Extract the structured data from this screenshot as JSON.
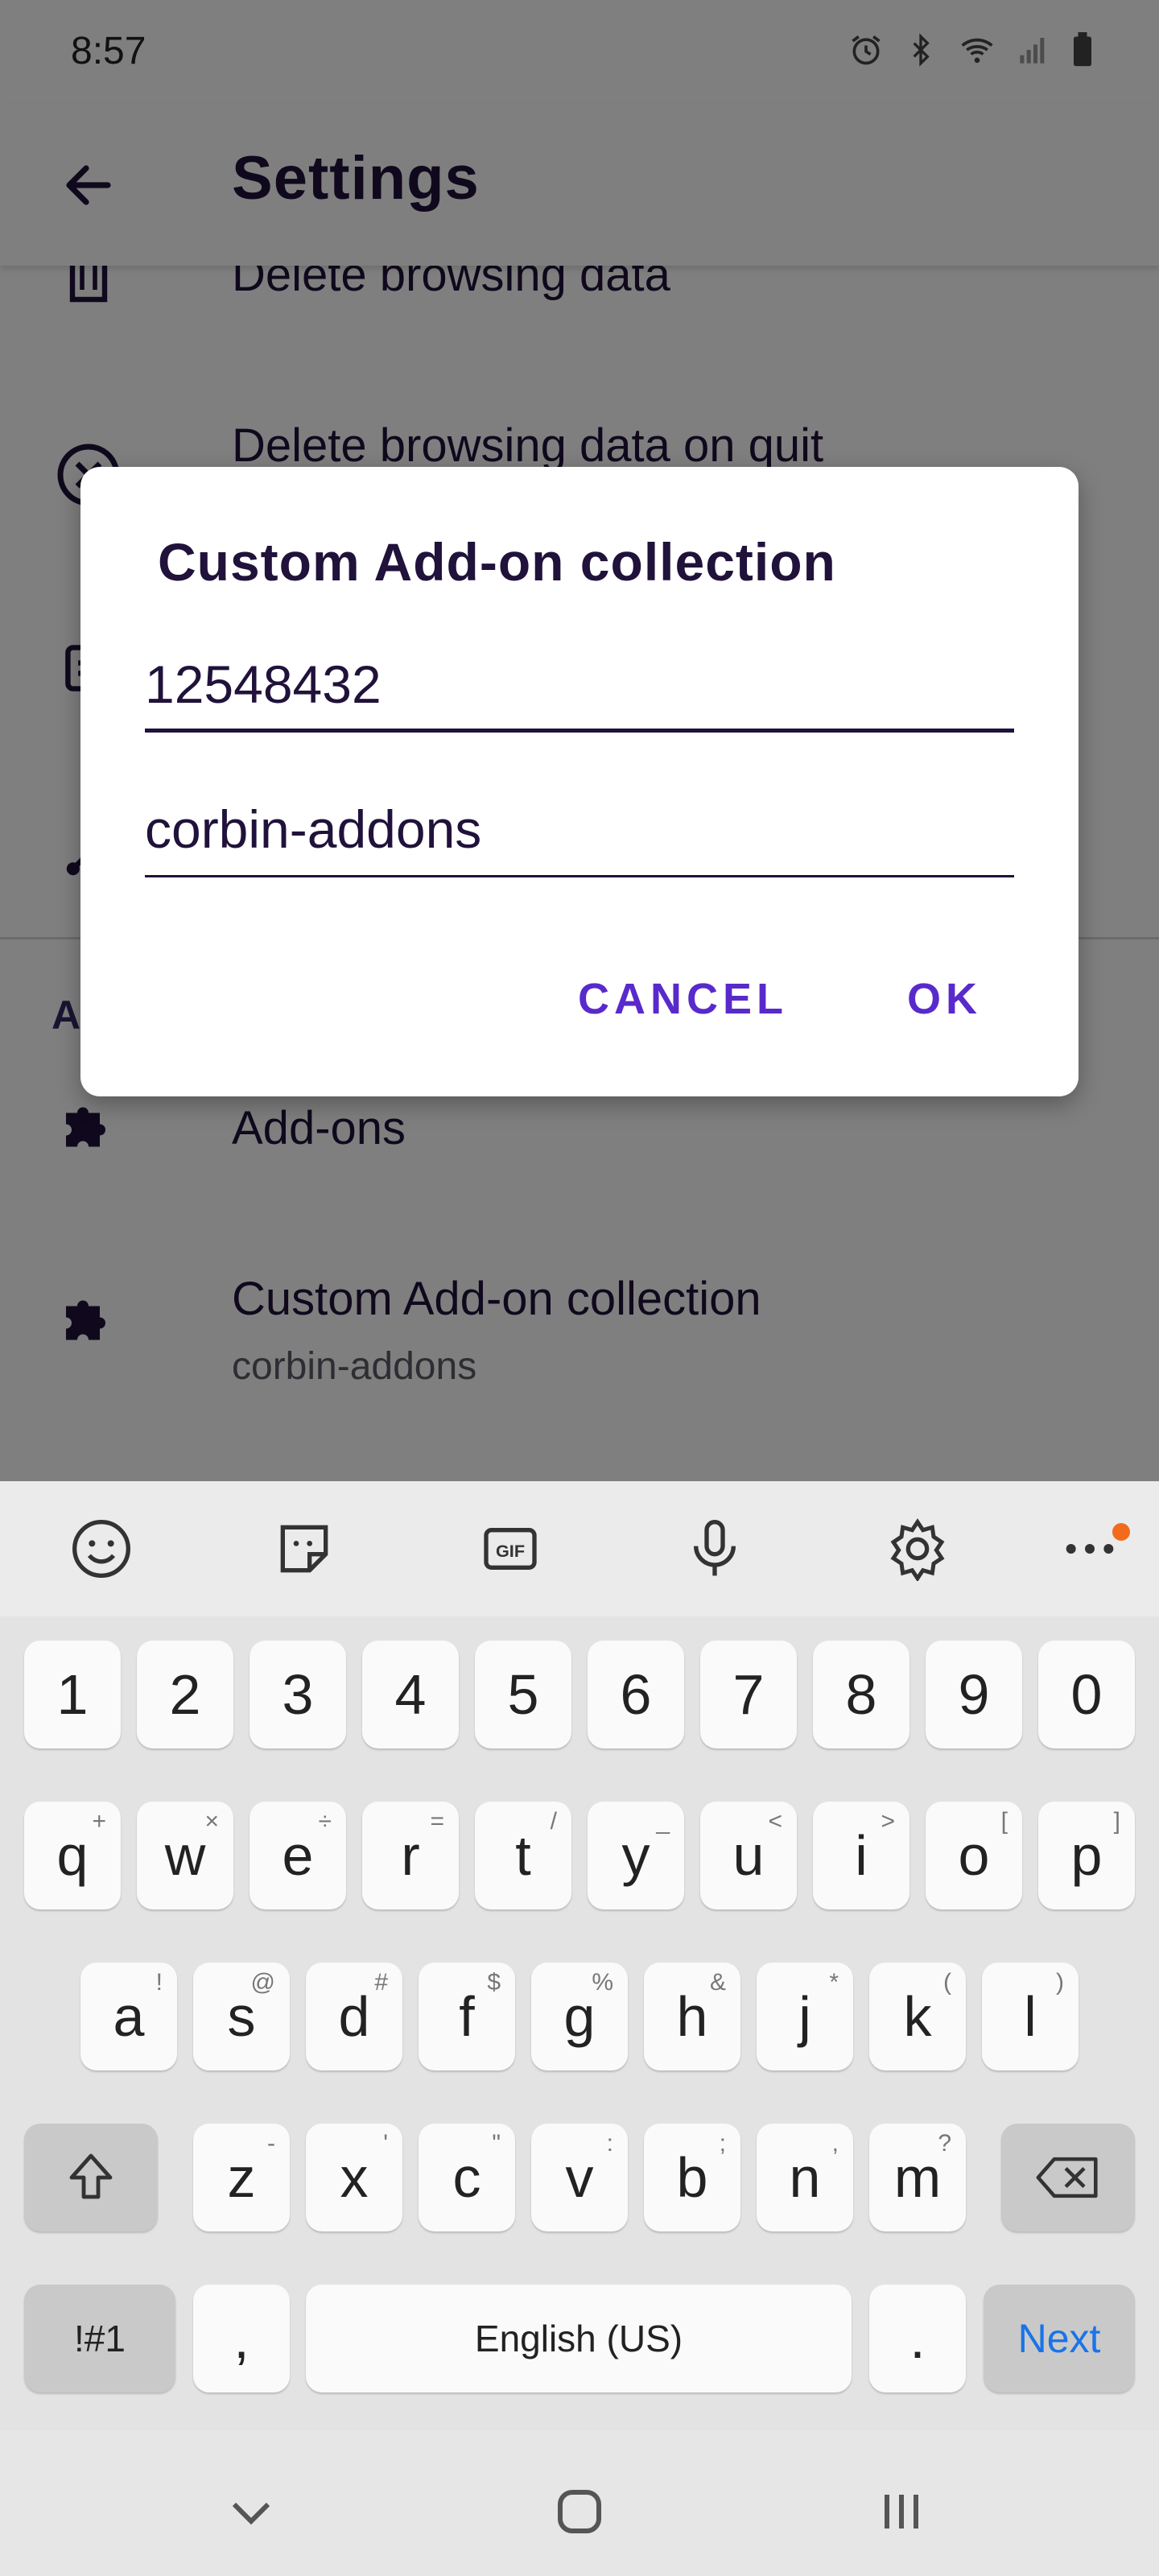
{
  "status_bar": {
    "time": "8:57",
    "icons": [
      "alarm-icon",
      "bluetooth-icon",
      "wifi-icon",
      "signal-icon",
      "battery-icon"
    ]
  },
  "app_bar": {
    "title": "Settings",
    "back_icon": "back-arrow-icon"
  },
  "settings": {
    "items": [
      {
        "title": "Delete browsing data",
        "icon": "trash-icon"
      },
      {
        "title": "Delete browsing data on quit",
        "icon": "close-circle-icon"
      },
      {
        "title": "",
        "icon": "document-icon"
      },
      {
        "title": "",
        "icon": "share-icon"
      },
      {
        "title": "Add-ons",
        "icon": "puzzle-icon"
      },
      {
        "title": "Custom Add-on collection",
        "summary": "corbin-addons",
        "icon": "puzzle-icon"
      }
    ],
    "section_header_letter": "A"
  },
  "dialog": {
    "title": "Custom Add-on collection",
    "collection_owner_value": "12548432",
    "collection_name_value": "corbin-addons",
    "cancel_label": "CANCEL",
    "ok_label": "OK"
  },
  "keyboard": {
    "toolbar": [
      "emoji-icon",
      "sticker-icon",
      "gif-icon",
      "microphone-icon",
      "settings-gear-icon",
      "more-icon"
    ],
    "gif_label": "GIF",
    "number_row": [
      "1",
      "2",
      "3",
      "4",
      "5",
      "6",
      "7",
      "8",
      "9",
      "0"
    ],
    "row1": [
      {
        "k": "q",
        "s": "+"
      },
      {
        "k": "w",
        "s": "×"
      },
      {
        "k": "e",
        "s": "÷"
      },
      {
        "k": "r",
        "s": "="
      },
      {
        "k": "t",
        "s": "/"
      },
      {
        "k": "y",
        "s": "_"
      },
      {
        "k": "u",
        "s": "<"
      },
      {
        "k": "i",
        "s": ">"
      },
      {
        "k": "o",
        "s": "["
      },
      {
        "k": "p",
        "s": "]"
      }
    ],
    "row2": [
      {
        "k": "a",
        "s": "!"
      },
      {
        "k": "s",
        "s": "@"
      },
      {
        "k": "d",
        "s": "#"
      },
      {
        "k": "f",
        "s": "$"
      },
      {
        "k": "g",
        "s": "%"
      },
      {
        "k": "h",
        "s": "&"
      },
      {
        "k": "j",
        "s": "*"
      },
      {
        "k": "k",
        "s": "("
      },
      {
        "k": "l",
        "s": ")"
      }
    ],
    "row3": [
      {
        "k": "z",
        "s": "-"
      },
      {
        "k": "x",
        "s": "'"
      },
      {
        "k": "c",
        "s": "\""
      },
      {
        "k": "v",
        "s": ":"
      },
      {
        "k": "b",
        "s": ";"
      },
      {
        "k": "n",
        "s": ","
      },
      {
        "k": "m",
        "s": "?"
      }
    ],
    "symbols_label": "!#1",
    "comma_label": ",",
    "space_label": "English (US)",
    "period_label": ".",
    "next_label": "Next"
  },
  "nav_bar": {
    "buttons": [
      "hide-keyboard-icon",
      "home-icon",
      "recents-icon"
    ]
  },
  "colors": {
    "accent": "#592acb",
    "text_primary": "#20123a",
    "scrim": "rgba(0,0,0,0.5)",
    "keyboard_next": "#1a73e8",
    "notification_dot": "#f26b1d"
  }
}
